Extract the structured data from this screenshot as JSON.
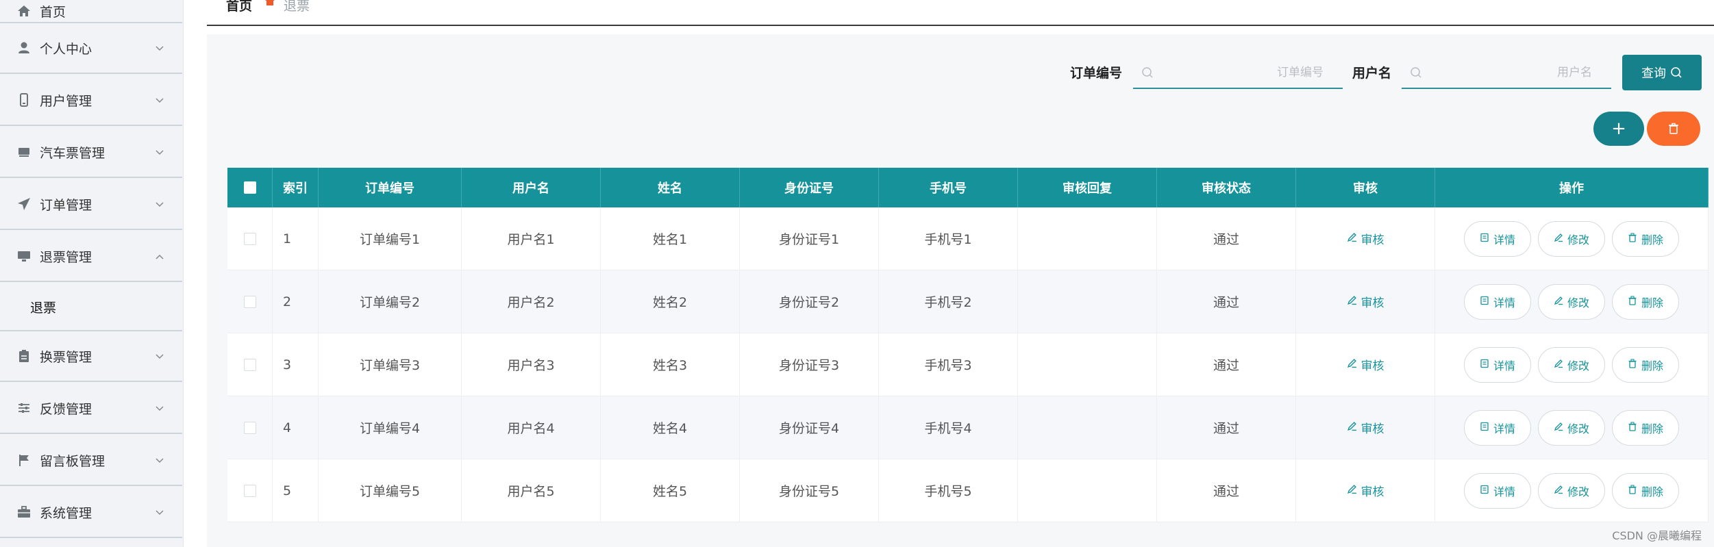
{
  "sidebar": {
    "items": [
      {
        "label": "首页",
        "icon": "home-icon"
      },
      {
        "label": "个人中心",
        "icon": "user-icon"
      },
      {
        "label": "用户管理",
        "icon": "phone-icon"
      },
      {
        "label": "汽车票管理",
        "icon": "bus-icon"
      },
      {
        "label": "订单管理",
        "icon": "send-icon"
      },
      {
        "label": "退票管理",
        "icon": "monitor-icon"
      },
      {
        "label": "换票管理",
        "icon": "clipboard-icon"
      },
      {
        "label": "反馈管理",
        "icon": "sliders-icon"
      },
      {
        "label": "留言板管理",
        "icon": "flag-icon"
      },
      {
        "label": "系统管理",
        "icon": "briefcase-icon"
      }
    ],
    "submenu": {
      "label": "退票"
    }
  },
  "breadcrumb": {
    "home": "首页",
    "current": "退票"
  },
  "search": {
    "order_label": "订单编号",
    "order_placeholder": "订单编号",
    "user_label": "用户名",
    "user_placeholder": "用户名",
    "query_label": "查询"
  },
  "actions": {
    "add_label": "+"
  },
  "table": {
    "headers": [
      "索引",
      "订单编号",
      "用户名",
      "姓名",
      "身份证号",
      "手机号",
      "审核回复",
      "审核状态",
      "审核",
      "操作"
    ],
    "rows": [
      {
        "index": "1",
        "order": "订单编号1",
        "user": "用户名1",
        "name": "姓名1",
        "id_card": "身份证号1",
        "phone": "手机号1",
        "reply": "",
        "status": "通过"
      },
      {
        "index": "2",
        "order": "订单编号2",
        "user": "用户名2",
        "name": "姓名2",
        "id_card": "身份证号2",
        "phone": "手机号2",
        "reply": "",
        "status": "通过"
      },
      {
        "index": "3",
        "order": "订单编号3",
        "user": "用户名3",
        "name": "姓名3",
        "id_card": "身份证号3",
        "phone": "手机号3",
        "reply": "",
        "status": "通过"
      },
      {
        "index": "4",
        "order": "订单编号4",
        "user": "用户名4",
        "name": "姓名4",
        "id_card": "身份证号4",
        "phone": "手机号4",
        "reply": "",
        "status": "通过"
      },
      {
        "index": "5",
        "order": "订单编号5",
        "user": "用户名5",
        "name": "姓名5",
        "id_card": "身份证号5",
        "phone": "手机号5",
        "reply": "",
        "status": "通过"
      }
    ],
    "audit_label": "审核",
    "detail_label": "详情",
    "edit_label": "修改",
    "delete_label": "删除"
  },
  "watermark": "CSDN @晨曦编程",
  "colors": {
    "accent": "#16939a",
    "danger": "#fa6a2a",
    "header_bg": "#16939a"
  }
}
